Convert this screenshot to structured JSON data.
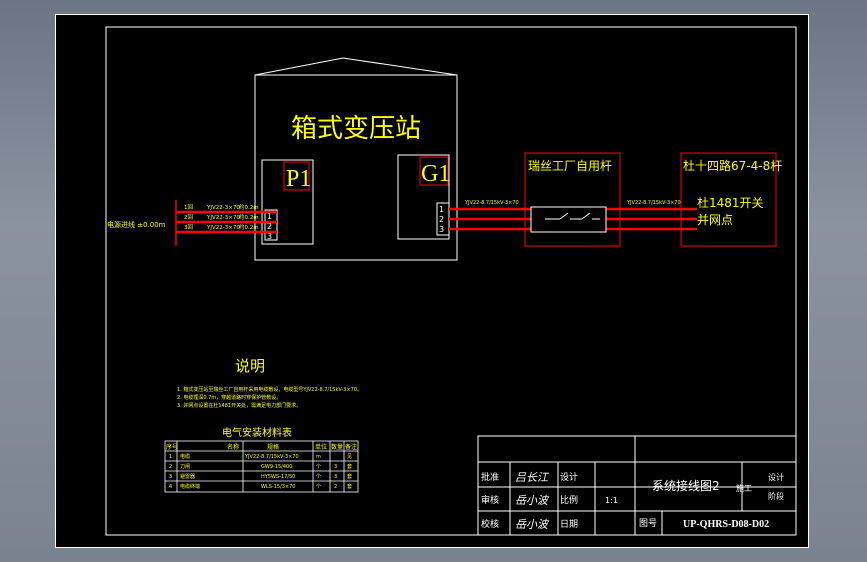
{
  "substation": {
    "title": "箱式变压站",
    "left_panel": "P1",
    "right_panel": "G1"
  },
  "source": {
    "label": "电源进线 ±0.00m"
  },
  "feeders": [
    {
      "phase": "1回",
      "cable": "YJV22-3×70",
      "length": "约0.2m"
    },
    {
      "phase": "2回",
      "cable": "YJV22-3×70",
      "length": "约0.2m"
    },
    {
      "phase": "3回",
      "cable": "YJV22-3×70",
      "length": "约0.2m"
    }
  ],
  "out_cable_left": "YJV22-8.7/15kV-3×70",
  "out_cable_right": "YJV22-8.7/15kV-3×70",
  "pole": {
    "title": "瑞丝工厂自用杆"
  },
  "line_box": {
    "title": "杜十四路67-4-8杆",
    "line1": "杜1481开关",
    "line2": "并网点"
  },
  "notes": {
    "title": "说明",
    "items": [
      "1. 箱式变压站至瑞丝工厂自用杆采用电缆敷设，电缆型号YJV22-8.7/15kV-3×70。",
      "2. 电缆埋深0.7m，穿越道路时穿保护管敷设。",
      "3. 并网点设置在杜1481开关处，需满足电力部门要求。"
    ]
  },
  "material_table": {
    "title": "电气安装材料表",
    "headers": [
      "序号",
      "名称",
      "规格",
      "单位",
      "数量",
      "备注"
    ],
    "rows": [
      [
        "1",
        "电缆",
        "YJV22-8.7/15kV-3×70",
        "m",
        "",
        "见"
      ],
      [
        "2",
        "刀闸",
        "GW9-15/400",
        "个",
        "3",
        "套"
      ],
      [
        "3",
        "避雷器",
        "HY5WS-17/50",
        "个",
        "3",
        "套"
      ],
      [
        "4",
        "电缆终端",
        "WLS-15/3×70",
        "个",
        "2",
        "套"
      ]
    ]
  },
  "title_block": {
    "r1_role": "批准",
    "r1_sign": "吕长江",
    "r1_role2": "设计",
    "r2_role": "审核",
    "r2_sign": "岳小波",
    "r2_role2": "比例",
    "r2_value": "1:1",
    "r3_role": "校核",
    "r3_sign": "岳小波",
    "r3_role2": "日期",
    "drawing_title": "系统接线图2",
    "stage": "施工",
    "r1_right": "设计",
    "r2_right": "阶段",
    "number_label": "图号",
    "number": "UP-QHRS-D08-D02"
  },
  "colors": {
    "frame": "#ffffff",
    "text": "#ffff00",
    "cable": "#ff0000",
    "box": "#ff0000"
  }
}
